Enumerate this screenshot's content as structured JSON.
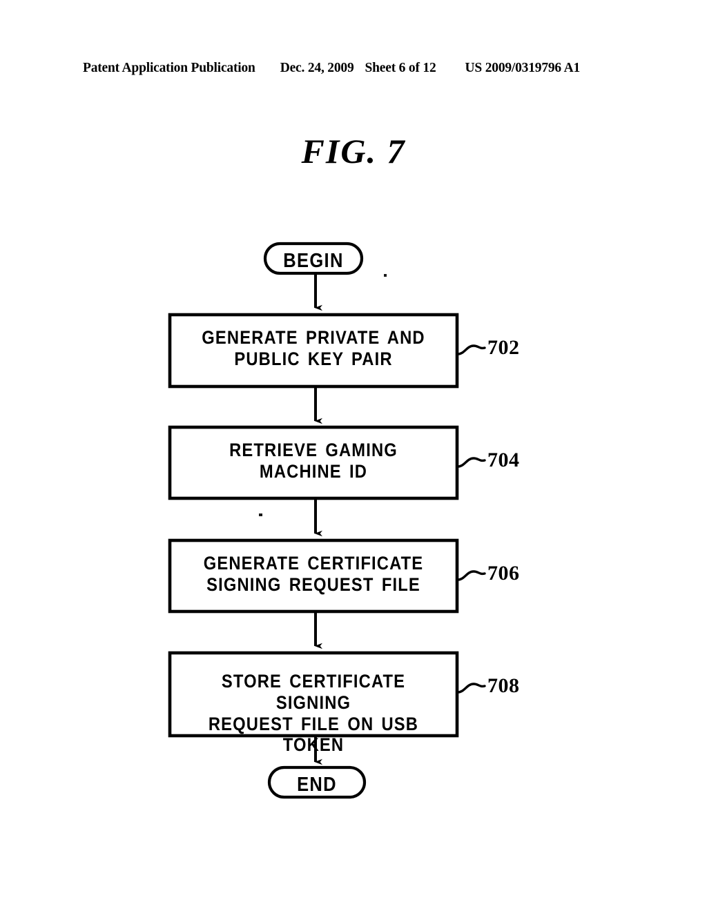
{
  "header": {
    "publication": "Patent Application Publication",
    "date": "Dec. 24, 2009",
    "sheet": "Sheet 6 of 12",
    "patent_number": "US 2009/0319796 A1"
  },
  "figure": {
    "title": "FIG. 7",
    "ink_color": "#000000",
    "background_color": "#ffffff"
  },
  "flowchart": {
    "start_node": {
      "label": "BEGIN",
      "shape": "stadium"
    },
    "end_node": {
      "label": "END",
      "shape": "stadium"
    },
    "steps": [
      {
        "ref": "702",
        "label": "GENERATE PRIVATE AND\nPUBLIC KEY PAIR",
        "line1": "GENERATE PRIVATE AND",
        "line2": "PUBLIC KEY PAIR",
        "shape": "rectangle"
      },
      {
        "ref": "704",
        "label": "RETRIEVE GAMING\nMACHINE ID",
        "line1": "RETRIEVE GAMING",
        "line2": "MACHINE ID",
        "shape": "rectangle"
      },
      {
        "ref": "706",
        "label": "GENERATE CERTIFICATE\nSIGNING REQUEST FILE",
        "line1": "GENERATE CERTIFICATE",
        "line2": "SIGNING REQUEST FILE",
        "shape": "rectangle"
      },
      {
        "ref": "708",
        "label": "STORE CERTIFICATE SIGNING\nREQUEST FILE ON USB TOKEN",
        "line1": "STORE CERTIFICATE SIGNING",
        "line2": "REQUEST FILE ON USB TOKEN",
        "shape": "rectangle"
      }
    ],
    "flow_direction": "top-to-bottom",
    "connector_count": 5
  }
}
